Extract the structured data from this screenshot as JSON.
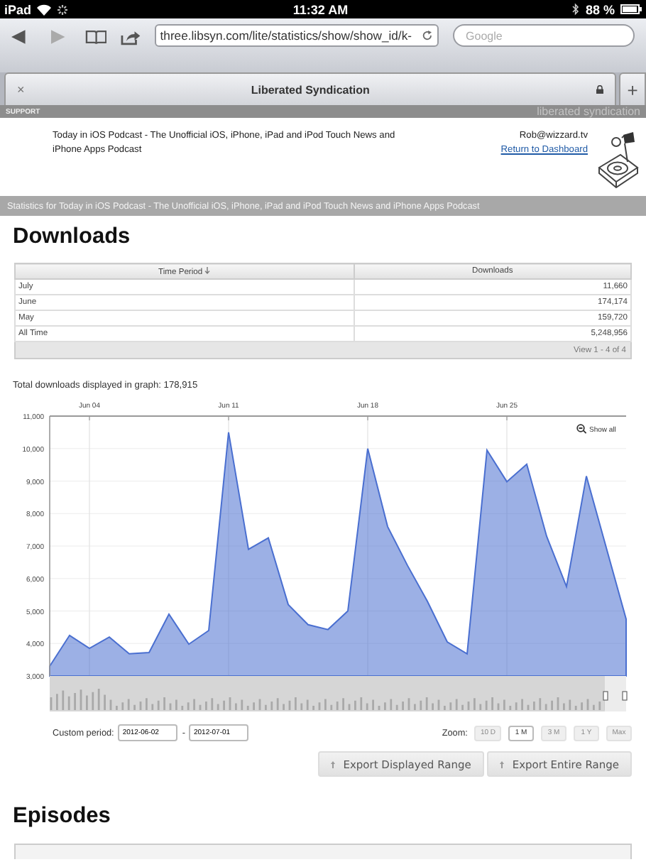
{
  "status_bar": {
    "device": "iPad",
    "time": "11:32 AM",
    "battery": "88 %"
  },
  "browser": {
    "back_enabled": true,
    "forward_enabled": false,
    "url": "three.libsyn.com/lite/statistics/show/show_id/k-",
    "search": {
      "placeholder": "Google"
    },
    "tab": {
      "close": "×",
      "title": "Liberated Syndication",
      "new_tab": "+"
    }
  },
  "site_bar": {
    "section": "SUPPORT",
    "brand": "liberated syndication"
  },
  "header": {
    "podcast": "Today in iOS Podcast - The Unofficial iOS, iPhone, iPad and iPod Touch News and iPhone Apps Podcast",
    "email": "Rob@wizzard.tv",
    "dashboard_link": "Return to Dashboard"
  },
  "stats_bar": "Statistics for Today in iOS Podcast - The Unofficial iOS, iPhone, iPad and iPod Touch News and iPhone Apps Podcast",
  "downloads": {
    "heading": "Downloads",
    "table": {
      "columns": [
        "Time Period",
        "Downloads"
      ],
      "rows": [
        [
          "July",
          "11,660"
        ],
        [
          "June",
          "174,174"
        ],
        [
          "May",
          "159,720"
        ],
        [
          "All Time",
          "5,248,956"
        ]
      ],
      "pager": "View 1 - 4 of 4"
    },
    "total": "Total downloads displayed in graph: 178,915",
    "chart_data": {
      "type": "area",
      "categories": [
        null,
        null,
        "Jun 04",
        null,
        null,
        null,
        null,
        null,
        null,
        "Jun 11",
        null,
        null,
        null,
        null,
        null,
        null,
        "Jun 18",
        null,
        null,
        null,
        null,
        null,
        null,
        "Jun 25",
        null,
        null,
        null,
        null,
        null,
        null
      ],
      "series": [
        {
          "color": "#4a6fd0",
          "values": [
            3300,
            4250,
            3850,
            4200,
            3680,
            3720,
            4900,
            3980,
            4400,
            10500,
            6900,
            7250,
            5200,
            4580,
            4430,
            5000,
            10000,
            7600,
            6400,
            5300,
            4050,
            3680,
            9950,
            8980,
            9520,
            7300,
            5750,
            9150,
            6950,
            4750
          ]
        }
      ],
      "ylim": [
        3000,
        11000
      ],
      "grid": true,
      "yticks": [
        {
          "value": 3000,
          "label": "3,000"
        },
        {
          "value": 4000,
          "label": "4,000"
        },
        {
          "value": 5000,
          "label": "5,000"
        },
        {
          "value": 6000,
          "label": "6,000"
        },
        {
          "value": 7000,
          "label": "7,000"
        },
        {
          "value": 8000,
          "label": "8,000"
        },
        {
          "value": 9000,
          "label": "9,000"
        },
        {
          "value": 10000,
          "label": "10,000"
        },
        {
          "value": 11000,
          "label": "11,000"
        }
      ]
    },
    "show_all": "Show all",
    "custom_period": {
      "label": "Custom period:",
      "from": "2012-06-02",
      "separator": "-",
      "to": "2012-07-01"
    },
    "zoom": {
      "label": "Zoom:",
      "options": [
        {
          "label": "10 D",
          "selected": false
        },
        {
          "label": "1 M",
          "selected": true
        },
        {
          "label": "3 M",
          "selected": false
        },
        {
          "label": "1 Y",
          "selected": false
        },
        {
          "label": "Max",
          "selected": false
        }
      ]
    },
    "exports": [
      "Export Displayed Range",
      "Export Entire Range"
    ]
  },
  "episodes": {
    "heading": "Episodes"
  }
}
